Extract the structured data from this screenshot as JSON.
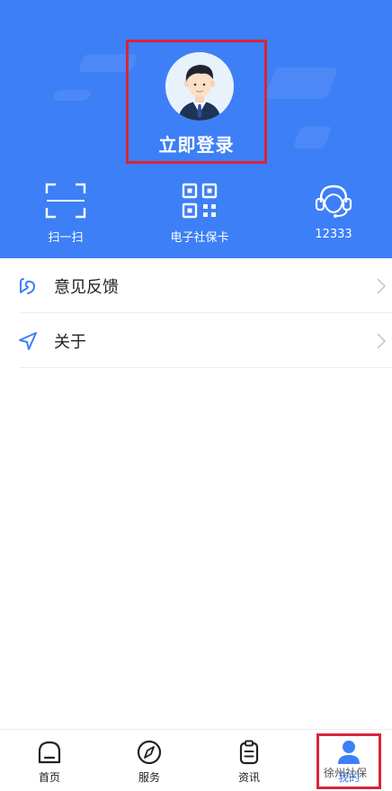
{
  "colors": {
    "primary": "#3d7ff6",
    "highlight_box": "#d8243a"
  },
  "header": {
    "login_label": "立即登录",
    "quick_actions": [
      {
        "label": "扫一扫",
        "icon": "scan-icon"
      },
      {
        "label": "电子社保卡",
        "icon": "qr-code-icon"
      },
      {
        "label": "12333",
        "icon": "headset-icon"
      }
    ]
  },
  "menu": [
    {
      "label": "意见反馈",
      "icon": "feedback-icon"
    },
    {
      "label": "关于",
      "icon": "navigation-arrow-icon"
    }
  ],
  "tabbar": {
    "active": "我的",
    "tabs": [
      {
        "label": "首页",
        "icon": "home-icon"
      },
      {
        "label": "服务",
        "icon": "compass-icon"
      },
      {
        "label": "资讯",
        "icon": "clipboard-icon"
      },
      {
        "label": "我的",
        "icon": "person-icon"
      }
    ]
  },
  "watermark": "徐州社保"
}
